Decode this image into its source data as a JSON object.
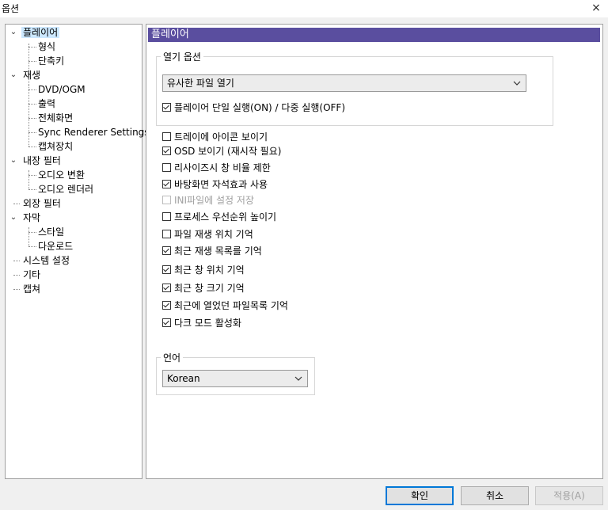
{
  "window": {
    "title": "옵션",
    "close_icon": "×"
  },
  "tree": {
    "chevron_glyph": "⌄",
    "chevron_right_glyph": "›",
    "items": [
      {
        "label": "플레이어"
      },
      {
        "label": "형식"
      },
      {
        "label": "단축키"
      },
      {
        "label": "재생"
      },
      {
        "label": "DVD/OGM"
      },
      {
        "label": "출력"
      },
      {
        "label": "전체화면"
      },
      {
        "label": "Sync Renderer Settings"
      },
      {
        "label": "캡쳐장치"
      },
      {
        "label": "내장 필터"
      },
      {
        "label": "오디오 변환"
      },
      {
        "label": "오디오 렌더러"
      },
      {
        "label": "외장 필터"
      },
      {
        "label": "자막"
      },
      {
        "label": "스타일"
      },
      {
        "label": "다운로드"
      },
      {
        "label": "시스템 설정"
      },
      {
        "label": "기타"
      },
      {
        "label": "캡쳐"
      }
    ]
  },
  "panel": {
    "header": "플레이어",
    "open_options": {
      "label": "열기 옵션",
      "dropdown_value": "유사한 파일 열기",
      "single_instance": {
        "label": "플레이어 단일 실행(ON) / 다중 실행(OFF)",
        "checked": true
      }
    },
    "checkboxes": [
      {
        "label": "트레이에 아이콘 보이기",
        "checked": false,
        "disabled": false
      },
      {
        "label": "OSD 보이기 (재시작 필요)",
        "checked": true,
        "disabled": false
      },
      {
        "label": "리사이즈시 창 비율 제한",
        "checked": false,
        "disabled": false
      },
      {
        "label": "바탕화면 자석효과 사용",
        "checked": true,
        "disabled": false
      },
      {
        "label": "INI파일에 설정 저장",
        "checked": false,
        "disabled": true
      },
      {
        "label": "프로세스 우선순위 높이기",
        "checked": false,
        "disabled": false
      },
      {
        "label": "파일 재생 위치 기억",
        "checked": false,
        "disabled": false
      },
      {
        "label": "최근 재생 목록를 기억",
        "checked": true,
        "disabled": false
      },
      {
        "label": "최근 창 위치 기억",
        "checked": true,
        "disabled": false
      },
      {
        "label": "최근 창 크기 기억",
        "checked": true,
        "disabled": false
      },
      {
        "label": "최근에 열었던 파일목록 기억",
        "checked": true,
        "disabled": false
      },
      {
        "label": "다크 모드 활성화",
        "checked": true,
        "disabled": false
      }
    ],
    "language": {
      "label": "언어",
      "dropdown_value": "Korean"
    }
  },
  "buttons": {
    "ok": "확인",
    "cancel": "취소",
    "apply": "적용(A)"
  }
}
